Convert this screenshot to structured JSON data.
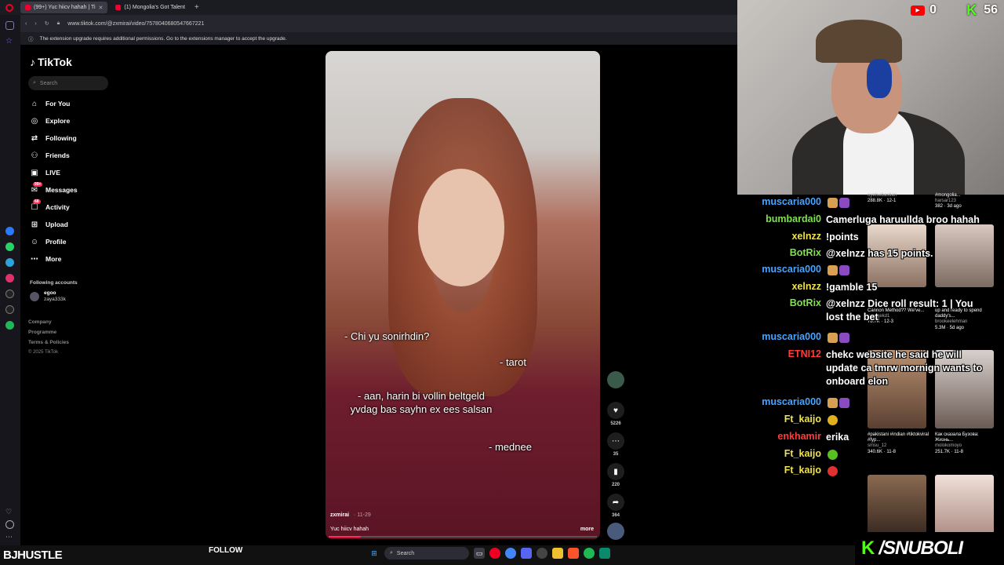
{
  "browser": {
    "tabs": [
      {
        "title": "(99+) Yuc hiicv hahah | Ti",
        "active": true
      },
      {
        "title": "(1) Mongolia's Got Talent",
        "active": false
      }
    ],
    "url": "www.tiktok.com/@zxmirai/video/7578040680547667221",
    "notice": "The extension upgrade requires additional permissions. Go to the extensions manager to accept the upgrade."
  },
  "tiktok": {
    "logo": "TikTok",
    "search_placeholder": "Search",
    "nav": [
      {
        "label": "For You",
        "icon": "home-icon"
      },
      {
        "label": "Explore",
        "icon": "compass-icon"
      },
      {
        "label": "Following",
        "icon": "following-icon"
      },
      {
        "label": "Friends",
        "icon": "friends-icon"
      },
      {
        "label": "LIVE",
        "icon": "live-icon"
      },
      {
        "label": "Messages",
        "icon": "messages-icon",
        "badge": "99+"
      },
      {
        "label": "Activity",
        "icon": "activity-icon",
        "badge": "68"
      },
      {
        "label": "Upload",
        "icon": "upload-icon"
      },
      {
        "label": "Profile",
        "icon": "profile-icon"
      },
      {
        "label": "More",
        "icon": "more-icon"
      }
    ],
    "following_header": "Following accounts",
    "following": [
      {
        "name": "egoo",
        "handle": "zaya333k"
      }
    ],
    "footer": [
      "Company",
      "Programme",
      "Terms & Policies",
      "© 2025 TikTok"
    ],
    "video": {
      "captions": [
        "- Chi yu sonirhdin?",
        "- tarot",
        "- aan, harin bi vollin beltgeld yvdag bas sayhn ex ees salsan",
        "- mednee"
      ],
      "username": "zxmirai",
      "date": "11-29",
      "description": "Yuc hiicv hahah",
      "more": "more",
      "progress": 0.12
    },
    "actions": {
      "likes": "5226",
      "comments": "35",
      "saves": "220",
      "shares": "364"
    }
  },
  "stream": {
    "youtube_count": "0",
    "kick_count": "56",
    "streamer_name": "BJHUSTLE",
    "follow_label": "FOLLOW",
    "kick_handle": "/SNUBOLI"
  },
  "chat": [
    {
      "user": "muscaria000",
      "color": "#4aa3ff",
      "text": ""
    },
    {
      "user": "bumbardai0",
      "color": "#7ee34b",
      "text": "Camerluga haruullda broo hahah"
    },
    {
      "user": "xelnzz",
      "color": "#f0e24a",
      "text": "!points"
    },
    {
      "user": "BotRix",
      "color": "#7ee34b",
      "text": "@xelnzz has 15 points."
    },
    {
      "user": "muscaria000",
      "color": "#4aa3ff",
      "text": ""
    },
    {
      "user": "xelnzz",
      "color": "#f0e24a",
      "text": "!gamble 15"
    },
    {
      "user": "BotRix",
      "color": "#7ee34b",
      "text": "@xelnzz Dice roll result: 1 | You lost the bet"
    },
    {
      "user": "muscaria000",
      "color": "#4aa3ff",
      "text": ""
    },
    {
      "user": "ETNI12",
      "color": "#ff3b3b",
      "text": "chekc website he said he will update ca tmrw mornign wants to onboard elon"
    },
    {
      "user": "muscaria000",
      "color": "#4aa3ff",
      "text": ""
    },
    {
      "user": "Ft_kaijo",
      "color": "#f0e24a",
      "text": ""
    },
    {
      "user": "enkhamir",
      "color": "#ff3b3b",
      "text": "erika"
    },
    {
      "user": "Ft_kaijo",
      "color": "#f0e24a",
      "text": ""
    },
    {
      "user": "Ft_kaijo",
      "color": "#f0e24a",
      "text": ""
    }
  ],
  "grid": [
    {
      "caption": "",
      "user": "oyetsebastian",
      "stats": "288.8K · 12-1"
    },
    {
      "caption": "#mongolia...",
      "user": "harsar123",
      "stats": "382 · 3d ago"
    },
    {
      "caption": "Cannon Method?? We've...",
      "user": "georgekd1",
      "stats": "78.7K · 12-3"
    },
    {
      "caption": "up and ready to spend daddy's...",
      "user": "brookeelehman",
      "stats": "5.3M · 5d ago"
    },
    {
      "caption": "#pakistani #indian #tiktokviral #fyp...",
      "user": "smsu_12",
      "stats": "340.6K · 11-8"
    },
    {
      "caption": "Как сказала Бузова: Жизнь...",
      "user": "molokomoyo",
      "stats": "251.7K · 11-8"
    }
  ],
  "taskbar": {
    "search": "Search"
  }
}
